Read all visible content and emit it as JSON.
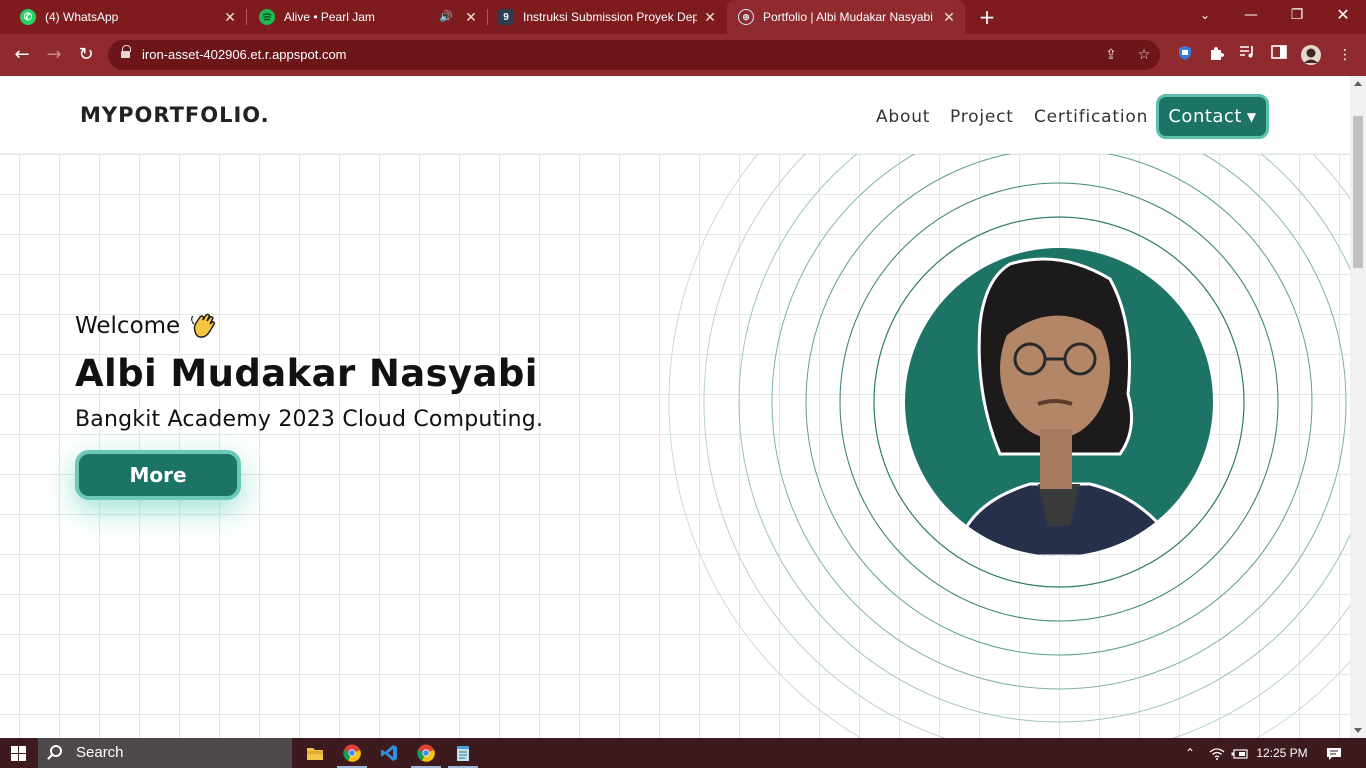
{
  "tabs": [
    {
      "title": "(4) WhatsApp",
      "icon": "whatsapp-icon"
    },
    {
      "title": "Alive • Pearl Jam",
      "icon": "spotify-icon"
    },
    {
      "title": "Instruksi Submission Proyek Dep",
      "icon": "dicoding-icon"
    },
    {
      "title": "Portfolio | Albi Mudakar Nasyabi",
      "icon": "globe-icon",
      "active": true
    }
  ],
  "address_bar": {
    "url": "iron-asset-402906.et.r.appspot.com"
  },
  "site": {
    "brand": "MYPORTFOLIO.",
    "nav": {
      "about": "About",
      "project": "Project",
      "certification": "Certification",
      "contact": "Contact"
    },
    "hero": {
      "welcome": "Welcome",
      "name": "Albi Mudakar Nasyabi",
      "subtitle": "Bangkit Academy 2023 Cloud Computing.",
      "more_label": "More"
    }
  },
  "taskbar": {
    "search_label": "Search",
    "time": "12:25 PM",
    "apps": [
      "file-explorer-icon",
      "chrome-icon",
      "vscode-icon",
      "chrome-icon",
      "notepad-icon"
    ]
  },
  "colors": {
    "accent": "#1e7367",
    "accent_light": "#5bc0ad",
    "chrome": "#8f2a2e",
    "tabbar": "#7d1b1f"
  }
}
